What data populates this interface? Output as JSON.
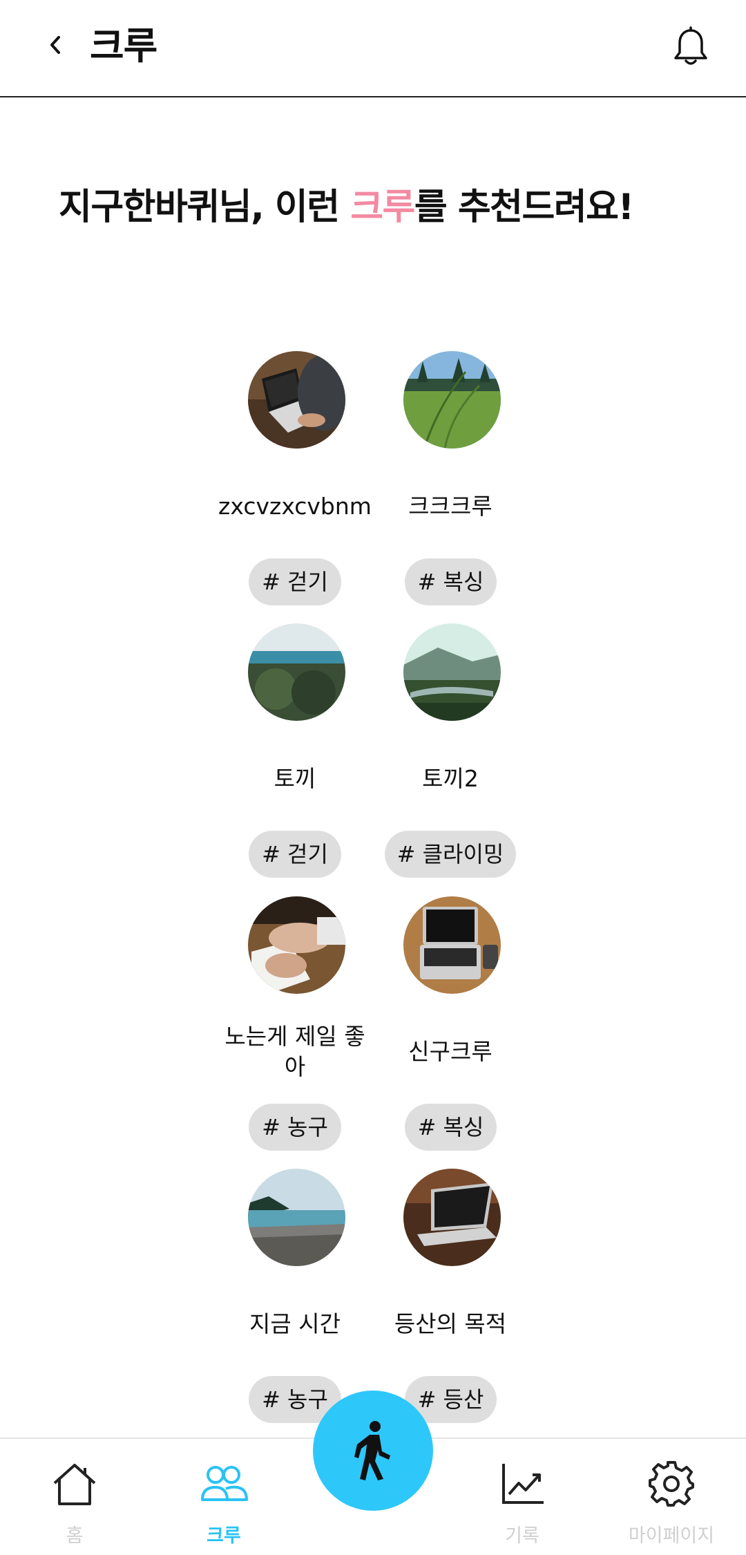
{
  "header": {
    "title": "크루"
  },
  "headline": {
    "prefix": "지구한바퀴님, 이런 ",
    "accent": "크루",
    "suffix": "를 추천드려요!"
  },
  "crews": [
    {
      "name": "zxcvzxcvbnm",
      "tag": "# 걷기"
    },
    {
      "name": "크크크루",
      "tag": "# 복싱"
    },
    {
      "name": "토끼",
      "tag": "# 걷기"
    },
    {
      "name": "토끼2",
      "tag": "# 클라이밍"
    },
    {
      "name": "노는게 제일 좋아",
      "tag": "# 농구"
    },
    {
      "name": "신구크루",
      "tag": "# 복싱"
    },
    {
      "name": "지금 시간",
      "tag": "# 농구"
    },
    {
      "name": "등산의 목적",
      "tag": "# 등산"
    }
  ],
  "nav": {
    "items": [
      {
        "label": "홈",
        "icon": "home-icon"
      },
      {
        "label": "크루",
        "icon": "users-icon"
      },
      {
        "label": "",
        "icon": "walking-person-icon"
      },
      {
        "label": "기록",
        "icon": "chart-line-icon"
      },
      {
        "label": "마이페이지",
        "icon": "gear-icon"
      }
    ]
  },
  "colors": {
    "accent_pink": "#f28aa2",
    "primary_blue": "#2ec7fa",
    "tag_background": "#dedede",
    "nav_inactive": "#cfcfcf"
  }
}
